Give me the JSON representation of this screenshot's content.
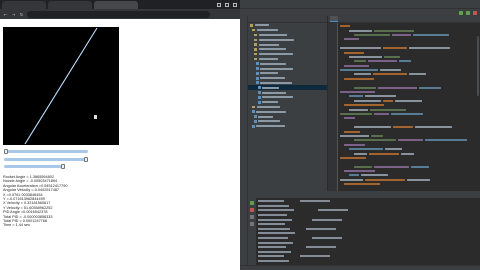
{
  "readouts": [
    "Rocket Angle = 1.3865594802",
    "Nozzle Angle = -0.00503471894",
    "Angular Acceleration =0.54512417790",
    "Angular Velocity =-0.0402517487",
    "X =0.0761 0033846454",
    "Y =-0.071613962844499",
    "X Velocity = 0.32181560617",
    "Y Velocity = 51.60358962252",
    "PID Angle =0.0016542378",
    "Total PID = -0.000003856333",
    "Total PID = 0.0001247768",
    "Time = 1.44 sec"
  ]
}
